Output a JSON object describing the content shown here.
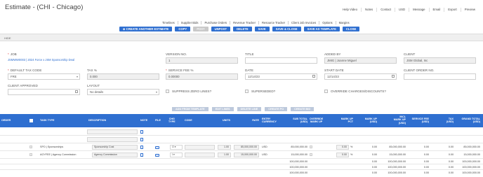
{
  "page": {
    "title": "Estimate - (CHI - Chicago)"
  },
  "util": [
    "Help Video",
    "Notes",
    "Contact",
    "USD",
    "Message",
    "Email",
    "Export",
    "Preview"
  ],
  "tabs": [
    "Timelines",
    "Supplier Bids",
    "Purchase Orders",
    "Revenue Tracker",
    "Resource Tracker",
    "Client Job Invoices",
    "Options",
    "Margins"
  ],
  "actions": {
    "create": "⊕ CREATE ANOTHER ESTIMATE",
    "copy": "COPY",
    "post": "POST",
    "unpost": "UNPOST",
    "delete": "DELETE",
    "save": "SAVE",
    "save_close": "SAVE & CLOSE",
    "save_template": "SAVE AS TEMPLATE",
    "close": "CLOSE"
  },
  "hide_label": "HIDE",
  "form": {
    "job_label": "JOB",
    "job_value": "JSMWW0003 | 2024 Force x JSM Sponsorship Deal",
    "version_label": "VERSION NO.",
    "version_value": "1",
    "title_label": "TITLE",
    "title_value": "",
    "added_by_label": "ADDED BY",
    "added_by_value": "JMIG | Joanne Miguel",
    "client_label": "CLIENT",
    "client_value": "JSM Global, Inc",
    "tax_code_label": "DEFAULT TAX CODE",
    "tax_code_value": "FRE",
    "tax_pct_label": "TAX %",
    "tax_pct_value": "0.000",
    "service_fee_label": "SERVICE FEE %",
    "service_fee_value": "0.00000",
    "date_label": "DATE",
    "date_value": "12/14/23",
    "start_date_label": "START DATE",
    "start_date_value": "12/14/23",
    "client_order_label": "CLIENT ORDER NO.",
    "client_order_value": "",
    "client_approved_label": "CLIENT APPROVED",
    "client_approved_value": "",
    "layout_label": "LAYOUT",
    "layout_value": "No details",
    "suppress_label": "SUPPRESS ZERO LINES?",
    "superseded_label": "SUPERSEDED?",
    "override_label": "OVERRIDE CHARGES/DISCOUNTS?"
  },
  "grid_buttons": [
    "ADD FROM TEMPLATE",
    "EDIT LINES",
    "DELETE LINE",
    "CREATE PO",
    "CREATE BID"
  ],
  "columns": {
    "order": "ORDER",
    "task_type": "TASK TYPE",
    "description": "DESCRIPTION",
    "note": "NOTE",
    "file": "FILE",
    "chg_type": "CHG\nTYPE",
    "code": "CODE",
    "units": "UNITS",
    "rate": "RATE",
    "entry_currency": "ENTRY\nCURRENCY",
    "sub_total": "SUB TOTAL\n(USD)",
    "override_markup": "OVERRIDE\nMARK UP",
    "markup_pct": "MARK UP\nPCT",
    "markup_usd": "MARK UP\n(USD)",
    "incl_markup": "INCL\nMARK UP\n(USD)",
    "service_fee": "SERVICE FEE\n(USD)",
    "tax": "TAX\n(USD)",
    "grand_total": "GRAND TOTAL\n(USD)"
  },
  "rows": [
    {
      "order": "",
      "task": "",
      "desc": "",
      "chg": "",
      "code": "",
      "units": "",
      "rate": "",
      "currency": "",
      "sub_total": "",
      "markup_pct": "",
      "markup_usd": "",
      "incl": "",
      "fee": "",
      "tax": "",
      "grand": ""
    },
    {
      "order": "",
      "task": "",
      "desc": "",
      "chg": "",
      "code": "",
      "units": "",
      "rate": "",
      "currency": "",
      "sub_total": "",
      "markup_pct": "",
      "markup_usd": "",
      "incl": "",
      "fee": "",
      "tax": "",
      "grand": ""
    },
    {
      "order": "",
      "task": "SPO | Sponsorships",
      "desc": "Sponsorship Cost",
      "chg": "O",
      "code": "",
      "units": "1.00",
      "rate": "85,000,000.00",
      "currency": "USD",
      "sub_total": "85,000,000.00",
      "markup_pct": "0.00",
      "markup_usd": "0.00",
      "incl": "85,000,000.00",
      "fee": "0.00",
      "tax": "0.00",
      "grand": "85,000,000.00"
    },
    {
      "order": "",
      "task": "AGYFEE | Agency Commission",
      "desc": "Agency Commission",
      "chg": "I",
      "code": "",
      "units": "1.00",
      "rate": "15,000,000.00",
      "currency": "USD",
      "sub_total": "15,000,000.00",
      "markup_pct": "0.00",
      "markup_usd": "0.00",
      "incl": "15,000,000.00",
      "fee": "0.00",
      "tax": "0.00",
      "grand": "15,000,000.00"
    }
  ],
  "totals": [
    {
      "sub_total": "100,000,000.00",
      "markup_usd": "0.00",
      "incl": "100,000,000.00",
      "fee": "0.00",
      "tax": "0.00",
      "grand": "100,000,000.00"
    },
    {
      "sub_total": "100,000,000.00",
      "markup_usd": "0.00",
      "incl": "100,000,000.00",
      "fee": "0.00",
      "tax": "0.00",
      "grand": "100,000,000.00"
    },
    {
      "sub_total": "100,000,000.00",
      "markup_usd": "0.00",
      "incl": "100,000,000.00",
      "fee": "0.00",
      "tax": "0.00",
      "grand": "100,000,000.00"
    }
  ],
  "pct_sign": "%",
  "colors": {
    "primary": "#2f6fd0",
    "required": "#e03030"
  }
}
